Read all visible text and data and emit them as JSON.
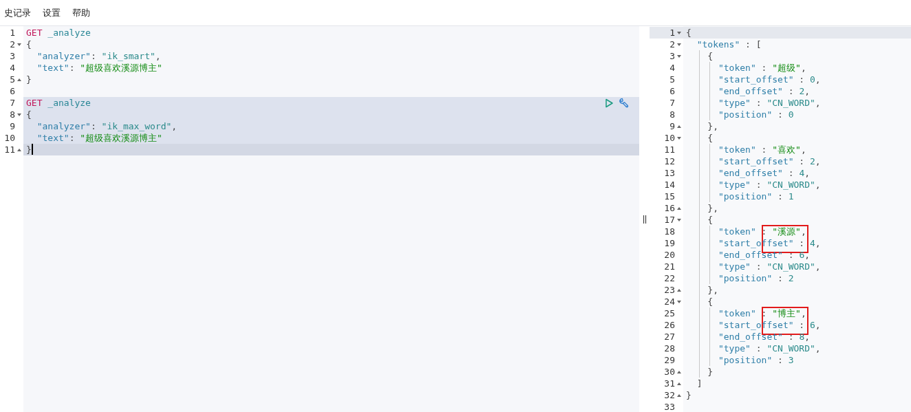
{
  "menu": [
    "史记录",
    "设置",
    "帮助"
  ],
  "request_editor": {
    "lines": [
      {
        "n": "1",
        "fold_open": false,
        "fold_close": false,
        "cursor": false,
        "active_block": false,
        "actions": false,
        "tokens": [
          {
            "kind": "method",
            "text": "GET"
          },
          {
            "kind": "path",
            "text": " _analyze"
          }
        ]
      },
      {
        "n": "2",
        "fold_open": true,
        "fold_close": false,
        "cursor": false,
        "active_block": false,
        "actions": false,
        "tokens": [
          {
            "kind": "punct",
            "text": "{"
          }
        ]
      },
      {
        "n": "3",
        "fold_open": false,
        "fold_close": false,
        "cursor": false,
        "active_block": false,
        "actions": false,
        "tokens": [
          {
            "kind": "key",
            "text": "  \"analyzer\""
          },
          {
            "kind": "punct",
            "text": ": "
          },
          {
            "kind": "string",
            "text": "\"ik_smart\""
          },
          {
            "kind": "punct",
            "text": ","
          }
        ]
      },
      {
        "n": "4",
        "fold_open": false,
        "fold_close": false,
        "cursor": false,
        "active_block": false,
        "actions": false,
        "tokens": [
          {
            "kind": "key",
            "text": "  \"text\""
          },
          {
            "kind": "punct",
            "text": ": "
          },
          {
            "kind": "cjk",
            "text": "\"超级喜欢溪源博主\""
          }
        ]
      },
      {
        "n": "5",
        "fold_open": false,
        "fold_close": true,
        "cursor": false,
        "active_block": false,
        "actions": false,
        "tokens": [
          {
            "kind": "punct",
            "text": "}"
          }
        ]
      },
      {
        "n": "6",
        "fold_open": false,
        "fold_close": false,
        "cursor": false,
        "active_block": false,
        "actions": false
      },
      {
        "n": "7",
        "fold_open": false,
        "fold_close": false,
        "cursor": false,
        "active_block": true,
        "actions": true,
        "tokens": [
          {
            "kind": "method",
            "text": "GET"
          },
          {
            "kind": "path",
            "text": " _analyze"
          }
        ]
      },
      {
        "n": "8",
        "fold_open": true,
        "fold_close": false,
        "cursor": false,
        "active_block": true,
        "actions": false,
        "tokens": [
          {
            "kind": "punct",
            "text": "{"
          }
        ]
      },
      {
        "n": "9",
        "fold_open": false,
        "fold_close": false,
        "cursor": false,
        "active_block": true,
        "actions": false,
        "tokens": [
          {
            "kind": "key",
            "text": "  \"analyzer\""
          },
          {
            "kind": "punct",
            "text": ": "
          },
          {
            "kind": "string",
            "text": "\"ik_max_word\""
          },
          {
            "kind": "punct",
            "text": ","
          }
        ]
      },
      {
        "n": "10",
        "fold_open": false,
        "fold_close": false,
        "cursor": false,
        "active_block": true,
        "actions": false,
        "tokens": [
          {
            "kind": "key",
            "text": "  \"text\""
          },
          {
            "kind": "punct",
            "text": ": "
          },
          {
            "kind": "cjk",
            "text": "\"超级喜欢溪源博主\""
          }
        ]
      },
      {
        "n": "11",
        "fold_open": false,
        "fold_close": true,
        "cursor": true,
        "active_block": true,
        "actions": false,
        "tokens": [
          {
            "kind": "punct",
            "text": "}"
          }
        ]
      }
    ]
  },
  "response_editor": {
    "lines": [
      {
        "n": "1",
        "fold_open": true,
        "fold_close": false,
        "cursor": true,
        "boxed": false,
        "tokens": [
          {
            "kind": "punct",
            "text": "{"
          }
        ]
      },
      {
        "n": "2",
        "fold_open": true,
        "fold_close": false,
        "cursor": false,
        "boxed": false,
        "tokens": [
          {
            "kind": "key",
            "text": "  \"tokens\""
          },
          {
            "kind": "punct",
            "text": " : ["
          }
        ]
      },
      {
        "n": "3",
        "fold_open": true,
        "fold_close": false,
        "cursor": false,
        "boxed": false,
        "tokens": [
          {
            "kind": "punct",
            "text": "    {"
          }
        ]
      },
      {
        "n": "4",
        "fold_open": false,
        "fold_close": false,
        "cursor": false,
        "boxed": false,
        "tokens": [
          {
            "kind": "key",
            "text": "      \"token\""
          },
          {
            "kind": "punct",
            "text": " : "
          },
          {
            "kind": "cjk",
            "text": "\"超级\""
          },
          {
            "kind": "punct",
            "text": ","
          }
        ]
      },
      {
        "n": "5",
        "fold_open": false,
        "fold_close": false,
        "cursor": false,
        "boxed": false,
        "tokens": [
          {
            "kind": "key",
            "text": "      \"start_offset\""
          },
          {
            "kind": "punct",
            "text": " : "
          },
          {
            "kind": "number",
            "text": "0"
          },
          {
            "kind": "punct",
            "text": ","
          }
        ]
      },
      {
        "n": "6",
        "fold_open": false,
        "fold_close": false,
        "cursor": false,
        "boxed": false,
        "tokens": [
          {
            "kind": "key",
            "text": "      \"end_offset\""
          },
          {
            "kind": "punct",
            "text": " : "
          },
          {
            "kind": "number",
            "text": "2"
          },
          {
            "kind": "punct",
            "text": ","
          }
        ]
      },
      {
        "n": "7",
        "fold_open": false,
        "fold_close": false,
        "cursor": false,
        "boxed": false,
        "tokens": [
          {
            "kind": "key",
            "text": "      \"type\""
          },
          {
            "kind": "punct",
            "text": " : "
          },
          {
            "kind": "string",
            "text": "\"CN_WORD\""
          },
          {
            "kind": "punct",
            "text": ","
          }
        ]
      },
      {
        "n": "8",
        "fold_open": false,
        "fold_close": false,
        "cursor": false,
        "boxed": false,
        "tokens": [
          {
            "kind": "key",
            "text": "      \"position\""
          },
          {
            "kind": "punct",
            "text": " : "
          },
          {
            "kind": "number",
            "text": "0"
          }
        ]
      },
      {
        "n": "9",
        "fold_open": false,
        "fold_close": true,
        "cursor": false,
        "boxed": false,
        "tokens": [
          {
            "kind": "punct",
            "text": "    },"
          }
        ]
      },
      {
        "n": "10",
        "fold_open": true,
        "fold_close": false,
        "cursor": false,
        "boxed": false,
        "tokens": [
          {
            "kind": "punct",
            "text": "    {"
          }
        ]
      },
      {
        "n": "11",
        "fold_open": false,
        "fold_close": false,
        "cursor": false,
        "boxed": false,
        "tokens": [
          {
            "kind": "key",
            "text": "      \"token\""
          },
          {
            "kind": "punct",
            "text": " : "
          },
          {
            "kind": "cjk",
            "text": "\"喜欢\""
          },
          {
            "kind": "punct",
            "text": ","
          }
        ]
      },
      {
        "n": "12",
        "fold_open": false,
        "fold_close": false,
        "cursor": false,
        "boxed": false,
        "tokens": [
          {
            "kind": "key",
            "text": "      \"start_offset\""
          },
          {
            "kind": "punct",
            "text": " : "
          },
          {
            "kind": "number",
            "text": "2"
          },
          {
            "kind": "punct",
            "text": ","
          }
        ]
      },
      {
        "n": "13",
        "fold_open": false,
        "fold_close": false,
        "cursor": false,
        "boxed": false,
        "tokens": [
          {
            "kind": "key",
            "text": "      \"end_offset\""
          },
          {
            "kind": "punct",
            "text": " : "
          },
          {
            "kind": "number",
            "text": "4"
          },
          {
            "kind": "punct",
            "text": ","
          }
        ]
      },
      {
        "n": "14",
        "fold_open": false,
        "fold_close": false,
        "cursor": false,
        "boxed": false,
        "tokens": [
          {
            "kind": "key",
            "text": "      \"type\""
          },
          {
            "kind": "punct",
            "text": " : "
          },
          {
            "kind": "string",
            "text": "\"CN_WORD\""
          },
          {
            "kind": "punct",
            "text": ","
          }
        ]
      },
      {
        "n": "15",
        "fold_open": false,
        "fold_close": false,
        "cursor": false,
        "boxed": false,
        "tokens": [
          {
            "kind": "key",
            "text": "      \"position\""
          },
          {
            "kind": "punct",
            "text": " : "
          },
          {
            "kind": "number",
            "text": "1"
          }
        ]
      },
      {
        "n": "16",
        "fold_open": false,
        "fold_close": true,
        "cursor": false,
        "boxed": false,
        "tokens": [
          {
            "kind": "punct",
            "text": "    },"
          }
        ]
      },
      {
        "n": "17",
        "fold_open": true,
        "fold_close": false,
        "cursor": false,
        "boxed": false,
        "tokens": [
          {
            "kind": "punct",
            "text": "    {"
          }
        ]
      },
      {
        "n": "18",
        "fold_open": false,
        "fold_close": false,
        "cursor": false,
        "boxed": true,
        "tokens": [
          {
            "kind": "key",
            "text": "      \"token\""
          },
          {
            "kind": "punct",
            "text": " : "
          },
          {
            "kind": "cjk",
            "text": "\"溪源\""
          },
          {
            "kind": "punct",
            "text": ","
          }
        ]
      },
      {
        "n": "19",
        "fold_open": false,
        "fold_close": false,
        "cursor": false,
        "boxed": false,
        "tokens": [
          {
            "kind": "key",
            "text": "      \"start_offset\""
          },
          {
            "kind": "punct",
            "text": " : "
          },
          {
            "kind": "number",
            "text": "4"
          },
          {
            "kind": "punct",
            "text": ","
          }
        ]
      },
      {
        "n": "20",
        "fold_open": false,
        "fold_close": false,
        "cursor": false,
        "boxed": false,
        "tokens": [
          {
            "kind": "key",
            "text": "      \"end_offset\""
          },
          {
            "kind": "punct",
            "text": " : "
          },
          {
            "kind": "number",
            "text": "6"
          },
          {
            "kind": "punct",
            "text": ","
          }
        ]
      },
      {
        "n": "21",
        "fold_open": false,
        "fold_close": false,
        "cursor": false,
        "boxed": false,
        "tokens": [
          {
            "kind": "key",
            "text": "      \"type\""
          },
          {
            "kind": "punct",
            "text": " : "
          },
          {
            "kind": "string",
            "text": "\"CN_WORD\""
          },
          {
            "kind": "punct",
            "text": ","
          }
        ]
      },
      {
        "n": "22",
        "fold_open": false,
        "fold_close": false,
        "cursor": false,
        "boxed": false,
        "tokens": [
          {
            "kind": "key",
            "text": "      \"position\""
          },
          {
            "kind": "punct",
            "text": " : "
          },
          {
            "kind": "number",
            "text": "2"
          }
        ]
      },
      {
        "n": "23",
        "fold_open": false,
        "fold_close": true,
        "cursor": false,
        "boxed": false,
        "tokens": [
          {
            "kind": "punct",
            "text": "    },"
          }
        ]
      },
      {
        "n": "24",
        "fold_open": true,
        "fold_close": false,
        "cursor": false,
        "boxed": false,
        "tokens": [
          {
            "kind": "punct",
            "text": "    {"
          }
        ]
      },
      {
        "n": "25",
        "fold_open": false,
        "fold_close": false,
        "cursor": false,
        "boxed": true,
        "tokens": [
          {
            "kind": "key",
            "text": "      \"token\""
          },
          {
            "kind": "punct",
            "text": " : "
          },
          {
            "kind": "cjk",
            "text": "\"博主\""
          },
          {
            "kind": "punct",
            "text": ","
          }
        ]
      },
      {
        "n": "26",
        "fold_open": false,
        "fold_close": false,
        "cursor": false,
        "boxed": false,
        "tokens": [
          {
            "kind": "key",
            "text": "      \"start_offset\""
          },
          {
            "kind": "punct",
            "text": " : "
          },
          {
            "kind": "number",
            "text": "6"
          },
          {
            "kind": "punct",
            "text": ","
          }
        ]
      },
      {
        "n": "27",
        "fold_open": false,
        "fold_close": false,
        "cursor": false,
        "boxed": false,
        "tokens": [
          {
            "kind": "key",
            "text": "      \"end_offset\""
          },
          {
            "kind": "punct",
            "text": " : "
          },
          {
            "kind": "number",
            "text": "8"
          },
          {
            "kind": "punct",
            "text": ","
          }
        ]
      },
      {
        "n": "28",
        "fold_open": false,
        "fold_close": false,
        "cursor": false,
        "boxed": false,
        "tokens": [
          {
            "kind": "key",
            "text": "      \"type\""
          },
          {
            "kind": "punct",
            "text": " : "
          },
          {
            "kind": "string",
            "text": "\"CN_WORD\""
          },
          {
            "kind": "punct",
            "text": ","
          }
        ]
      },
      {
        "n": "29",
        "fold_open": false,
        "fold_close": false,
        "cursor": false,
        "boxed": false,
        "tokens": [
          {
            "kind": "key",
            "text": "      \"position\""
          },
          {
            "kind": "punct",
            "text": " : "
          },
          {
            "kind": "number",
            "text": "3"
          }
        ]
      },
      {
        "n": "30",
        "fold_open": false,
        "fold_close": true,
        "cursor": false,
        "boxed": false,
        "tokens": [
          {
            "kind": "punct",
            "text": "    }"
          }
        ]
      },
      {
        "n": "31",
        "fold_open": false,
        "fold_close": true,
        "cursor": false,
        "boxed": false,
        "tokens": [
          {
            "kind": "punct",
            "text": "  ]"
          }
        ]
      },
      {
        "n": "32",
        "fold_open": false,
        "fold_close": true,
        "cursor": false,
        "boxed": false,
        "tokens": [
          {
            "kind": "punct",
            "text": "}"
          }
        ]
      },
      {
        "n": "33",
        "fold_open": false,
        "fold_close": false,
        "cursor": false,
        "boxed": false
      }
    ]
  }
}
